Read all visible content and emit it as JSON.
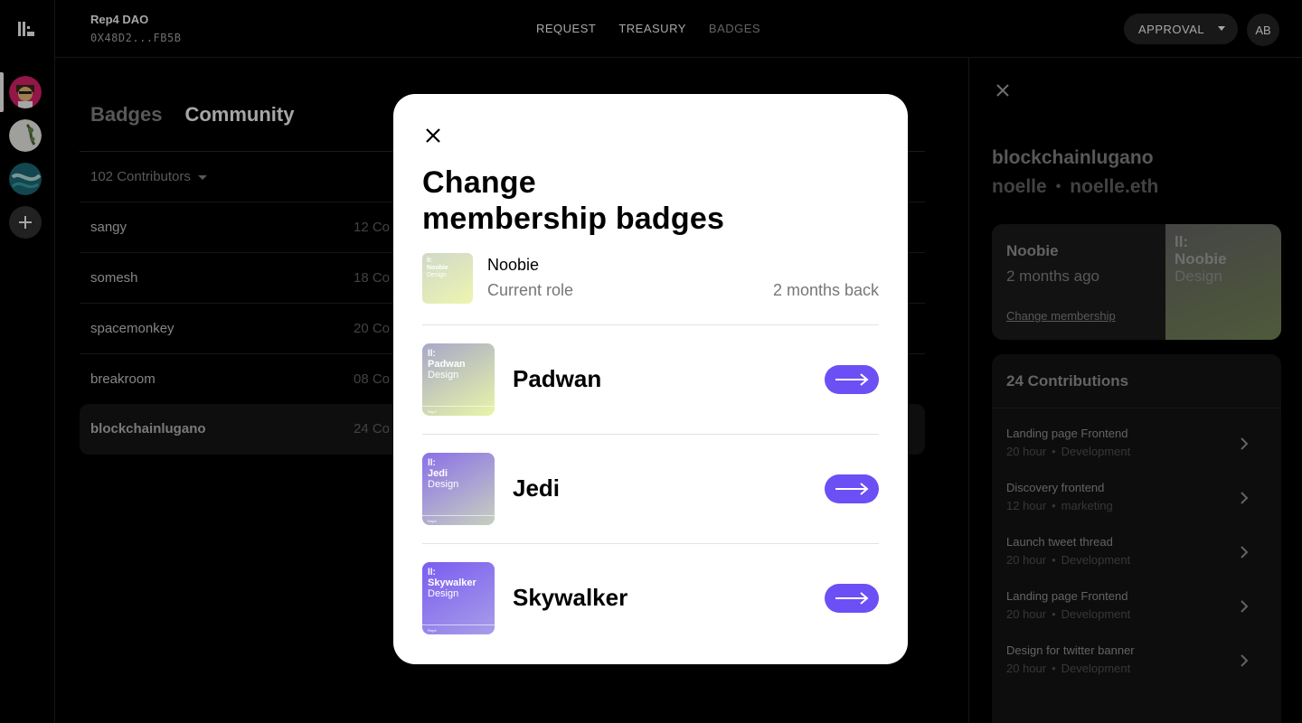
{
  "app": {
    "dao_name": "Rep4 DAO",
    "dao_address": "0X48D2...FB5B"
  },
  "nav": {
    "items": [
      {
        "label": "REQUEST"
      },
      {
        "label": "TREASURY"
      },
      {
        "label": "BADGES"
      }
    ],
    "approval_label": "APPROVAL",
    "avatar_initials": "AB"
  },
  "community": {
    "tabs": [
      {
        "label": "Badges"
      },
      {
        "label": "Community"
      }
    ],
    "contributors_label": "102 Contributors",
    "rows": [
      {
        "name": "sangy",
        "value": "12 Co"
      },
      {
        "name": "somesh",
        "value": "18 Co"
      },
      {
        "name": "spacemonkey",
        "value": "20 Co"
      },
      {
        "name": "breakroom",
        "value": "08 Co"
      },
      {
        "name": "blockchainlugano",
        "value": "24 Co"
      }
    ]
  },
  "profile": {
    "handle": "blockchainlugano",
    "alias": "noelle",
    "ens": "noelle.eth",
    "role": {
      "title": "Noobie",
      "ago": "2 months ago",
      "link": "Change membership",
      "art_title": "Noobie",
      "art_sub": "Design"
    },
    "contributions_title": "24 Contributions",
    "contributions": [
      {
        "title": "Landing page Frontend",
        "hours": "20 hour",
        "type": "Development"
      },
      {
        "title": "Discovery frontend",
        "hours": "12 hour",
        "type": "marketing"
      },
      {
        "title": "Launch tweet thread",
        "hours": "20 hour",
        "type": "Development"
      },
      {
        "title": "Landing page Frontend",
        "hours": "20 hour",
        "type": "Development"
      },
      {
        "title": "Design for twitter banner",
        "hours": "20 hour",
        "type": "Development"
      }
    ]
  },
  "modal": {
    "title_line1": "Change",
    "title_line2": "membership badges",
    "current": {
      "name": "Noobie",
      "subtitle": "Current role",
      "when": "2 months back",
      "badge_title": "Noobie",
      "badge_sub": "Design"
    },
    "options": [
      {
        "name": "Padwan",
        "badge_title": "Padwan",
        "badge_sub": "Design",
        "badge_footer": "Rep4"
      },
      {
        "name": "Jedi",
        "badge_title": "Jedi",
        "badge_sub": "Design",
        "badge_footer": "Rep4"
      },
      {
        "name": "Skywalker",
        "badge_title": "Skywalker",
        "badge_sub": "Design",
        "badge_footer": "Rep4"
      }
    ],
    "accent_color": "#6c4ff5"
  },
  "icons": {
    "logo": "rep4-logo-icon",
    "close": "close-icon",
    "arrow": "arrow-right-icon",
    "chevron": "chevron-right-icon",
    "plus": "plus-icon"
  }
}
